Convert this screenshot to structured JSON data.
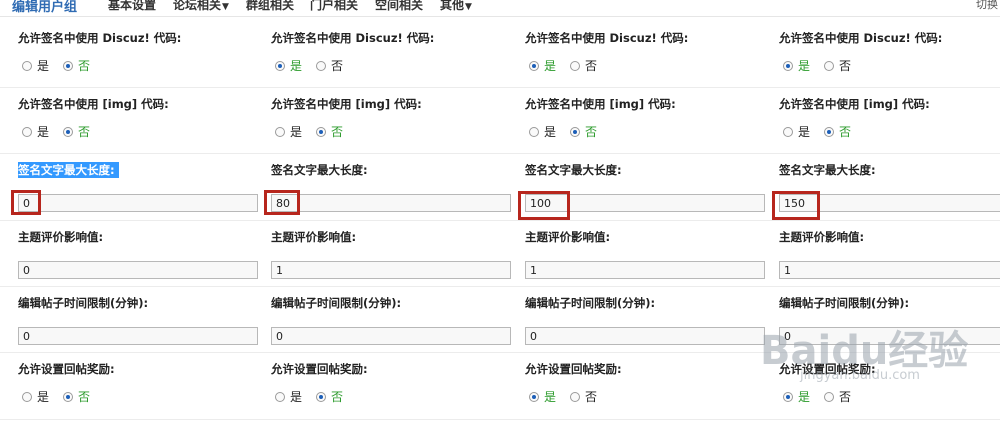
{
  "nav": {
    "items": [
      {
        "label": "编辑用户组",
        "active": true,
        "dropdown": false
      },
      {
        "label": "基本设置",
        "active": false,
        "dropdown": false
      },
      {
        "label": "论坛相关",
        "active": false,
        "dropdown": true
      },
      {
        "label": "群组相关",
        "active": false,
        "dropdown": false
      },
      {
        "label": "门户相关",
        "active": false,
        "dropdown": false
      },
      {
        "label": "空间相关",
        "active": false,
        "dropdown": false
      },
      {
        "label": "其他",
        "active": false,
        "dropdown": true
      }
    ],
    "switch_label": "切换"
  },
  "radio_options": {
    "yes": "是",
    "no": "否"
  },
  "rows": [
    {
      "type": "radio",
      "columns": [
        {
          "label": "允许签名中使用 Discuz! 代码:",
          "selected": "no"
        },
        {
          "label": "允许签名中使用 Discuz! 代码:",
          "selected": "yes"
        },
        {
          "label": "允许签名中使用 Discuz! 代码:",
          "selected": "yes"
        },
        {
          "label": "允许签名中使用 Discuz! 代码:",
          "selected": "yes"
        }
      ]
    },
    {
      "type": "radio",
      "columns": [
        {
          "label": "允许签名中使用 [img] 代码:",
          "selected": "no"
        },
        {
          "label": "允许签名中使用 [img] 代码:",
          "selected": "no"
        },
        {
          "label": "允许签名中使用 [img] 代码:",
          "selected": "no"
        },
        {
          "label": "允许签名中使用 [img] 代码:",
          "selected": "no"
        }
      ]
    },
    {
      "type": "input",
      "columns": [
        {
          "label": "签名文字最大长度:",
          "value": "0",
          "highlight_label": true,
          "boxed": true
        },
        {
          "label": "签名文字最大长度:",
          "value": "80",
          "highlight_label": false,
          "boxed": true
        },
        {
          "label": "签名文字最大长度:",
          "value": "100",
          "highlight_label": false,
          "boxed": true
        },
        {
          "label": "签名文字最大长度:",
          "value": "150",
          "highlight_label": false,
          "boxed": true
        }
      ]
    },
    {
      "type": "input",
      "columns": [
        {
          "label": "主题评价影响值:",
          "value": "0"
        },
        {
          "label": "主题评价影响值:",
          "value": "1"
        },
        {
          "label": "主题评价影响值:",
          "value": "1"
        },
        {
          "label": "主题评价影响值:",
          "value": "1"
        }
      ]
    },
    {
      "type": "input",
      "columns": [
        {
          "label": "编辑帖子时间限制(分钟):",
          "value": "0"
        },
        {
          "label": "编辑帖子时间限制(分钟):",
          "value": "0"
        },
        {
          "label": "编辑帖子时间限制(分钟):",
          "value": "0"
        },
        {
          "label": "编辑帖子时间限制(分钟):",
          "value": "0"
        }
      ]
    },
    {
      "type": "radio",
      "columns": [
        {
          "label": "允许设置回帖奖励:",
          "selected": "no"
        },
        {
          "label": "允许设置回帖奖励:",
          "selected": "no"
        },
        {
          "label": "允许设置回帖奖励:",
          "selected": "yes"
        },
        {
          "label": "允许设置回帖奖励:",
          "selected": "yes"
        }
      ]
    }
  ],
  "watermark": {
    "brand": "Baidu经验",
    "url": "jingyan.baidu.com"
  },
  "colors": {
    "accent": "#2f6bb3",
    "selected_text": "#2a9a2a",
    "label_highlight": "#3399ff",
    "annotation_box": "#b7261d"
  }
}
